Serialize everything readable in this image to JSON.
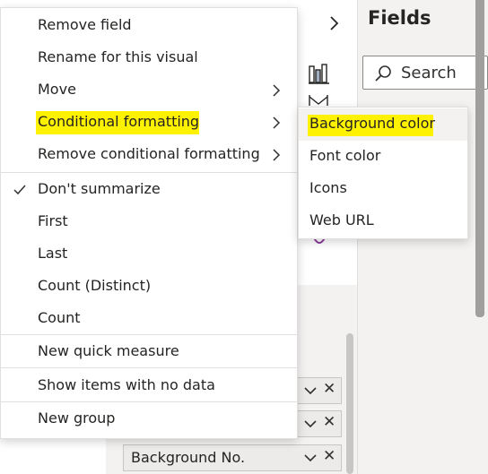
{
  "fields_pane": {
    "title": "Fields",
    "search_placeholder": "Search",
    "search_icon": "search-icon"
  },
  "viz_pane": {
    "expand_icon": "chevron-right-icon"
  },
  "context_menu": {
    "items": [
      {
        "label": "Remove field"
      },
      {
        "label": "Rename for this visual"
      },
      {
        "label": "Move",
        "has_submenu": true
      },
      {
        "label": "Conditional formatting",
        "has_submenu": true,
        "highlighted": true
      },
      {
        "label": "Remove conditional formatting",
        "has_submenu": true
      },
      {
        "label": "Don't summarize",
        "checked": true
      },
      {
        "label": "First"
      },
      {
        "label": "Last"
      },
      {
        "label": "Count (Distinct)"
      },
      {
        "label": "Count"
      },
      {
        "label": "New quick measure"
      },
      {
        "label": "Show items with no data"
      },
      {
        "label": "New group"
      }
    ]
  },
  "submenu": {
    "items": [
      {
        "label": "Background color",
        "highlighted": true
      },
      {
        "label": "Font color"
      },
      {
        "label": "Icons"
      },
      {
        "label": "Web URL"
      }
    ]
  },
  "field_wells": {
    "items": [
      {
        "label": ""
      },
      {
        "label": ""
      },
      {
        "label": "Background No."
      }
    ]
  },
  "colors": {
    "highlight": "#fff200",
    "pane_background": "#f3f2f1",
    "menu_text": "#252423"
  }
}
